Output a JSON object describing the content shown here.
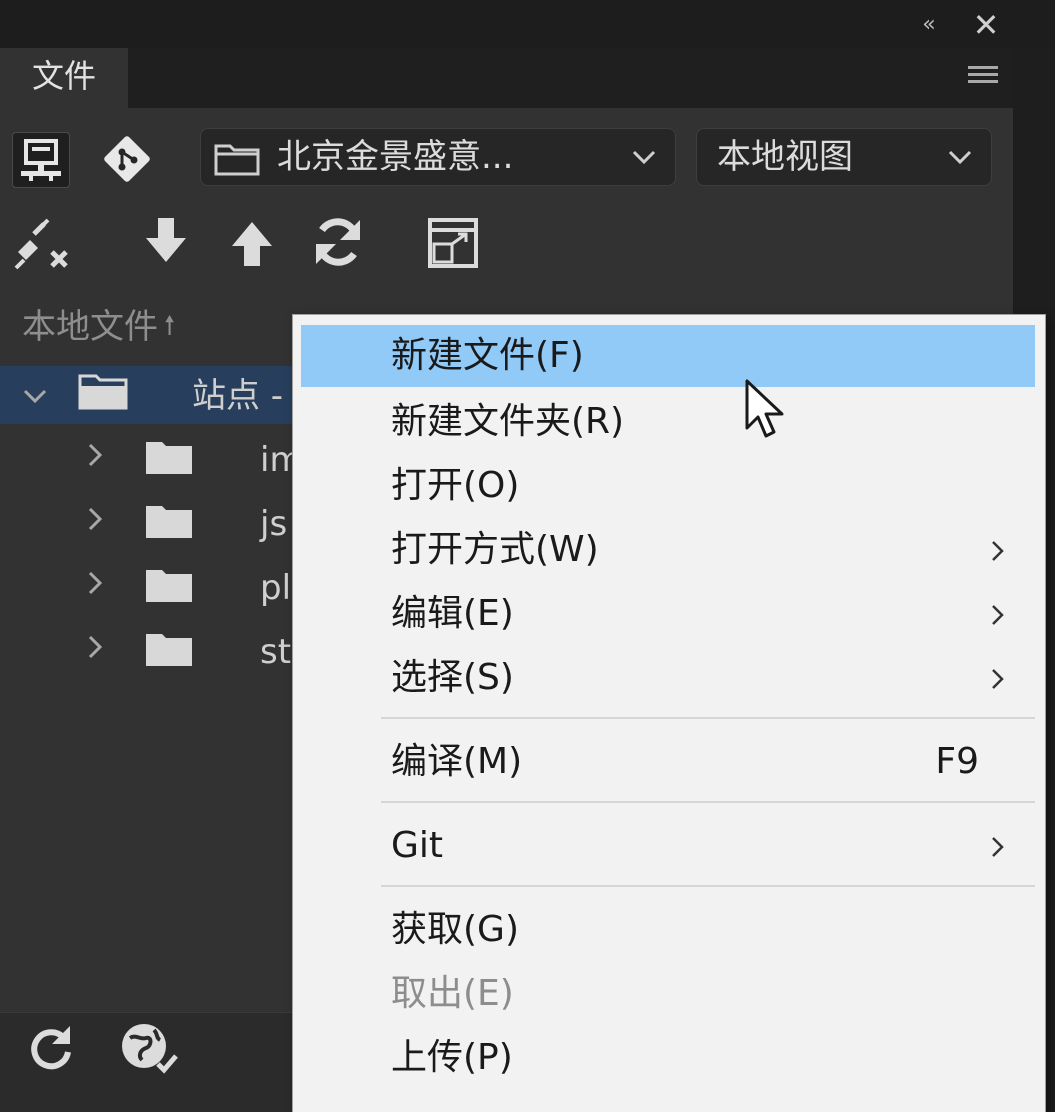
{
  "panel": {
    "tab_label": "文件",
    "site_dropdown": "北京金景盛意...",
    "view_dropdown": "本地视图",
    "local_files_header": "本地文件",
    "local_files_sort_icon": "arrow-up-icon"
  },
  "tree": {
    "root_label": "站点 -",
    "items": [
      {
        "label": "im"
      },
      {
        "label": "js"
      },
      {
        "label": "pl"
      },
      {
        "label": "st"
      }
    ]
  },
  "context_menu": {
    "items": [
      {
        "label": "新建文件(F)",
        "state": "highlighted"
      },
      {
        "label": "新建文件夹(R)"
      },
      {
        "label": "打开(O)"
      },
      {
        "label": "打开方式(W)",
        "submenu": true
      },
      {
        "label": "编辑(E)",
        "submenu": true
      },
      {
        "label": "选择(S)",
        "submenu": true
      },
      {
        "label": "编译(M)",
        "shortcut": "F9"
      },
      {
        "label": "Git",
        "submenu": true
      },
      {
        "label": "获取(G)"
      },
      {
        "label": "取出(E)",
        "state": "disabled"
      },
      {
        "label": "上传(P)"
      }
    ]
  },
  "colors": {
    "menu_highlight": "#91c9f7",
    "tree_selection": "#273f5c",
    "panel_bg": "#323232"
  }
}
